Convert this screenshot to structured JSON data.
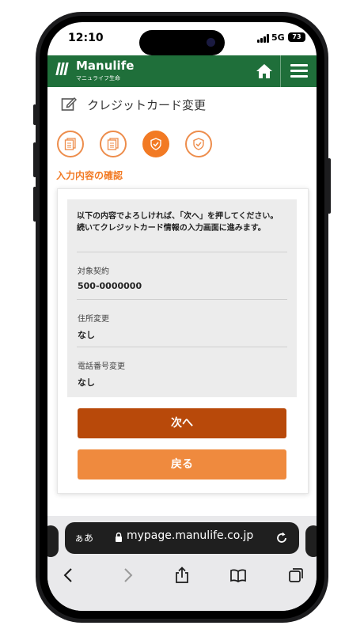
{
  "status_bar": {
    "time": "12:10",
    "network": "5G",
    "battery": "73"
  },
  "header": {
    "brand": "Manulife",
    "brand_sub": "マニュライフ生命",
    "colors": {
      "bar": "#1f6f3a",
      "accent": "#f27a24",
      "next_button": "#b8490a",
      "back_button": "#ef8a3e"
    }
  },
  "page": {
    "title": "クレジットカード変更",
    "step_label": "入力内容の確認"
  },
  "steps": [
    {
      "icon": "document-icon",
      "state": "done"
    },
    {
      "icon": "document-icon",
      "state": "done"
    },
    {
      "icon": "shield-check-icon",
      "state": "current"
    },
    {
      "icon": "shield-check-icon",
      "state": "pending"
    }
  ],
  "confirm": {
    "intro": "以下の内容でよろしければ、「次へ」を押してください。続いてクレジットカード情報の入力画面に進みます。",
    "fields": [
      {
        "label": "対象契約",
        "value": "500-0000000"
      },
      {
        "label": "住所変更",
        "value": "なし"
      },
      {
        "label": "電話番号変更",
        "value": "なし"
      }
    ],
    "next_label": "次へ",
    "back_label": "戻る"
  },
  "browser": {
    "text_size": "ぁあ",
    "url": "mypage.manulife.co.jp"
  }
}
